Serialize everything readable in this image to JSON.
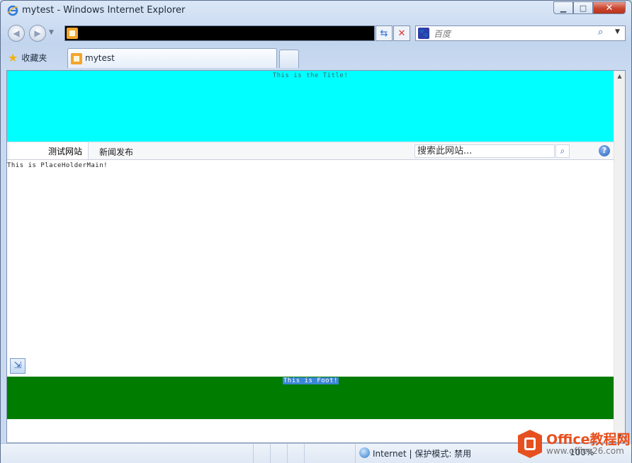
{
  "window": {
    "title": "mytest - Windows Internet Explorer",
    "min_glyph": "▁",
    "max_glyph": "□",
    "close_glyph": "✕"
  },
  "nav": {
    "back_glyph": "◀",
    "forward_glyph": "▶",
    "dropdown_glyph": "▼",
    "address_value": "",
    "refresh_glyph": "⇆",
    "stop_glyph": "✕",
    "search_placeholder": "百度",
    "search_provider_glyph": "🐾",
    "search_go_glyph": "⌕",
    "search_dropdown_glyph": "▼"
  },
  "favorites": {
    "label": "收藏夹",
    "star_glyph": "★"
  },
  "tabs": [
    {
      "label": "mytest"
    }
  ],
  "page": {
    "title_text": "This is the Title!",
    "nav_items": [
      "测试网站",
      "新闻发布"
    ],
    "site_search_placeholder": "搜索此网站...",
    "site_search_go_glyph": "⌕",
    "help_glyph": "?",
    "main_text": "This is PlaceHolderMain!",
    "corner_icon_glyph": "⇲",
    "foot_text": "This is Foot!",
    "colors": {
      "title_band": "#00ffff",
      "foot_band": "#007c00"
    }
  },
  "scrollbar": {
    "up_glyph": "▲",
    "down_glyph": "▼"
  },
  "status": {
    "zone": "Internet | 保护模式: 禁用",
    "zoom": "100%"
  },
  "watermark": {
    "name": "Office教程网",
    "url": "www.office26.com"
  }
}
